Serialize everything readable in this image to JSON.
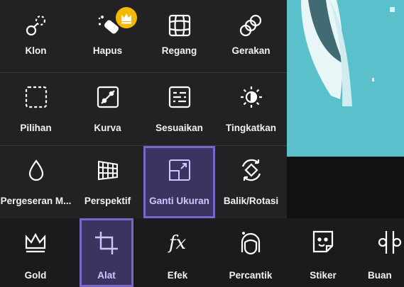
{
  "tools_grid": {
    "rows": [
      [
        {
          "label": "Klon",
          "icon": "clone-icon"
        },
        {
          "label": "Hapus",
          "icon": "eraser-icon",
          "premium": true
        },
        {
          "label": "Regang",
          "icon": "stretch-grid-icon"
        },
        {
          "label": "Gerakan",
          "icon": "motion-icon"
        }
      ],
      [
        {
          "label": "Pilihan",
          "icon": "selection-icon"
        },
        {
          "label": "Kurva",
          "icon": "curves-icon"
        },
        {
          "label": "Sesuaikan",
          "icon": "adjust-icon"
        },
        {
          "label": "Tingkatkan",
          "icon": "enhance-icon"
        }
      ],
      [
        {
          "label": "Pergeseran M...",
          "icon": "tilt-shift-icon"
        },
        {
          "label": "Perspektif",
          "icon": "perspective-icon"
        },
        {
          "label": "Ganti Ukuran",
          "icon": "resize-icon",
          "selected": true
        },
        {
          "label": "Balik/Rotasi",
          "icon": "flip-rotate-icon"
        }
      ]
    ]
  },
  "bottom_toolbar": {
    "items": [
      {
        "label": "Gold",
        "icon": "crown-icon"
      },
      {
        "label": "Alat",
        "icon": "crop-tool-icon",
        "selected": true
      },
      {
        "label": "Efek",
        "icon": "fx-icon"
      },
      {
        "label": "Percantik",
        "icon": "beautify-face-icon"
      },
      {
        "label": "Stiker",
        "icon": "sticker-icon"
      },
      {
        "label": "Buan",
        "icon": "cutout-icon"
      }
    ]
  },
  "colors": {
    "accent": "#7a66c9",
    "selected_bg": "#3b3461",
    "premium_badge": "#f5b800",
    "preview_teal": "#5ac1cc"
  }
}
